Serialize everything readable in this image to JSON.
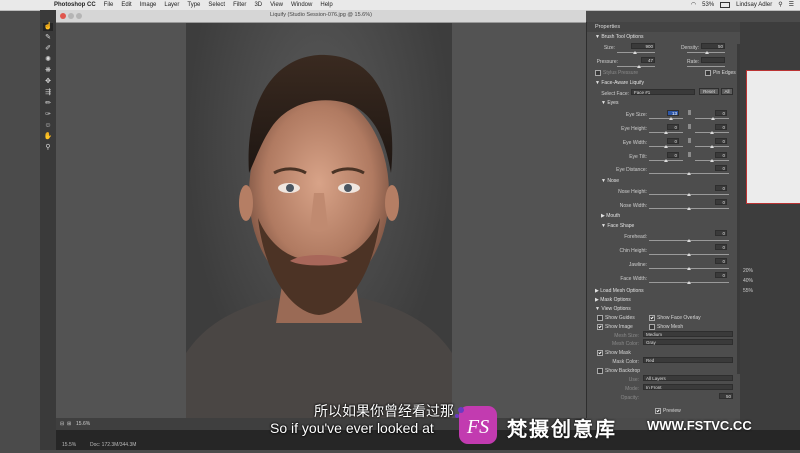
{
  "menubar": {
    "apple": "",
    "app": "Photoshop CC",
    "items": [
      "File",
      "Edit",
      "Image",
      "Layer",
      "Type",
      "Select",
      "Filter",
      "3D",
      "View",
      "Window",
      "Help"
    ],
    "battery": "53%",
    "user": "Lindsay Adler"
  },
  "window": {
    "title": "Liquify (Studio Session-076.jpg @ 15.6%)"
  },
  "status": {
    "zoom": "15.6%",
    "left_zoom": "15.5%",
    "doc": "Doc: 172.3M/344.3M"
  },
  "panel": {
    "title": "Properties",
    "brush": {
      "header": "Brush Tool Options",
      "size_label": "Size:",
      "size_value": "900",
      "density_label": "Density:",
      "density_value": "50",
      "pressure_label": "Pressure:",
      "pressure_value": "47",
      "rate_label": "Rate:",
      "rate_value": "",
      "stylus_label": "Stylus Pressure",
      "pin_label": "Pin Edges"
    },
    "face": {
      "header": "Face-Aware Liquify",
      "select_label": "Select Face:",
      "select_value": "Face #1",
      "reset": "Reset",
      "all": "All",
      "eyes": {
        "header": "Eyes",
        "rows": [
          {
            "label": "Eye Size:",
            "left": "13",
            "right": "0"
          },
          {
            "label": "Eye Height:",
            "left": "0",
            "right": "0"
          },
          {
            "label": "Eye Width:",
            "left": "0",
            "right": "0"
          },
          {
            "label": "Eye Tilt:",
            "left": "0",
            "right": "0"
          }
        ],
        "distance_label": "Eye Distance:",
        "distance_value": "0"
      },
      "nose": {
        "header": "Nose",
        "height_label": "Nose Height:",
        "height_value": "0",
        "width_label": "Nose Width:",
        "width_value": "0"
      },
      "mouth": {
        "header": "Mouth"
      },
      "shape": {
        "header": "Face Shape",
        "rows": [
          {
            "label": "Forehead:",
            "value": "0"
          },
          {
            "label": "Chin Height:",
            "value": "0"
          },
          {
            "label": "Jawline:",
            "value": "0"
          },
          {
            "label": "Face Width:",
            "value": "0"
          }
        ]
      }
    },
    "load_mesh": "Load Mesh Options",
    "mask_options": "Mask Options",
    "view": {
      "header": "View Options",
      "show_guides": "Show Guides",
      "show_face_overlay": "Show Face Overlay",
      "show_image": "Show Image",
      "show_mesh": "Show Mesh",
      "mesh_size_label": "Mesh Size:",
      "mesh_size_value": "Medium",
      "mesh_color_label": "Mesh Color:",
      "mesh_color_value": "Gray",
      "show_mask": "Show Mask",
      "mask_color_label": "Mask Color:",
      "mask_color_value": "Red",
      "show_backdrop": "Show Backdrop",
      "use_label": "Use:",
      "use_value": "All Layers",
      "mode_label": "Mode:",
      "mode_value": "In Front",
      "opacity_label": "Opacity:",
      "opacity_value": "50"
    },
    "preview": "Preview"
  },
  "right_strip": {
    "pct1": "20%",
    "pct2": "40%",
    "pct3": "55%"
  },
  "subtitles": {
    "cn": "所以如果你曾经看过那",
    "en": "So if you've ever looked at"
  },
  "watermark": {
    "logo": "FS",
    "name": "梵摄创意库",
    "url": "WWW.FSTVC.CC"
  },
  "colors": {
    "accent": "#2e57a8",
    "watermark": "#c23bb0"
  }
}
